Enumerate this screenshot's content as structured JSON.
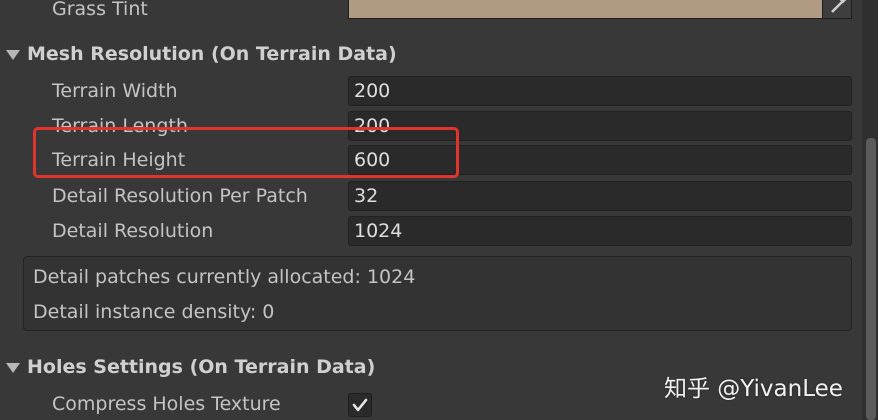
{
  "grass": {
    "label": "Grass Tint",
    "swatch_color": "#b09a82",
    "picker_icon": "eyedropper-icon"
  },
  "mesh_resolution": {
    "header": "Mesh Resolution (On Terrain Data)",
    "fields": [
      {
        "label": "Terrain Width",
        "value": "200"
      },
      {
        "label": "Terrain Length",
        "value": "200"
      },
      {
        "label": "Terrain Height",
        "value": "600"
      },
      {
        "label": "Detail Resolution Per Patch",
        "value": "32"
      },
      {
        "label": "Detail Resolution",
        "value": "1024"
      }
    ],
    "info": [
      "Detail patches currently allocated: 1024",
      "Detail instance density: 0"
    ]
  },
  "holes": {
    "header": "Holes Settings (On Terrain Data)",
    "compress_label": "Compress Holes Texture",
    "compress_checked": true
  },
  "annotation_color": "#e0342c",
  "watermark": "知乎 @YivanLee"
}
